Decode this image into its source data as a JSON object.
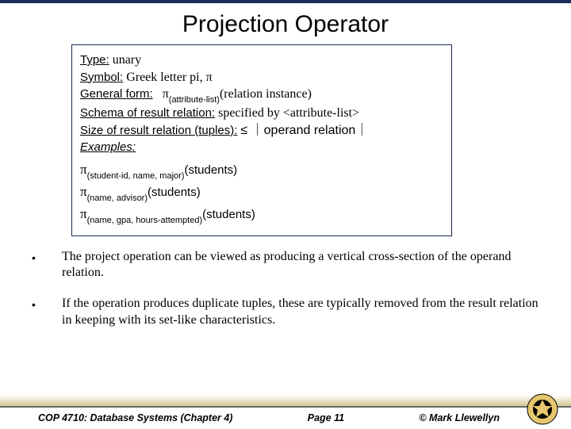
{
  "title": "Projection Operator",
  "box": {
    "type_label": "Type:",
    "type_value": "unary",
    "symbol_label": "Symbol:",
    "symbol_value": "Greek letter pi, π",
    "form_label": "General form:",
    "form_pi": "π",
    "form_sub": "(attribute-list)",
    "form_tail": "(relation instance)",
    "schema_label": "Schema of result relation:",
    "schema_value": "specified by <attribute-list>",
    "size_label": "Size of result relation (tuples):",
    "size_value": "≤ ｜operand relation｜",
    "examples_label": "Examples:"
  },
  "examples": {
    "e1": {
      "pi": "π",
      "sub": "(student-id, name, major)",
      "rel": "(students)"
    },
    "e2": {
      "pi": "π",
      "sub": "(name, advisor)",
      "rel": "(students)"
    },
    "e3": {
      "pi": "π",
      "sub": "(name, gpa, hours-attempted)",
      "rel": "(students)"
    }
  },
  "bullets": {
    "b1": "The project operation can be viewed as producing a vertical cross-section of the operand relation.",
    "b2": "If the operation produces duplicate tuples, these are typically removed from the result relation in keeping with its set-like characteristics."
  },
  "footer": {
    "course": "COP 4710: Database Systems  (Chapter 4)",
    "page": "Page 11",
    "copyright": "© Mark Llewellyn"
  }
}
